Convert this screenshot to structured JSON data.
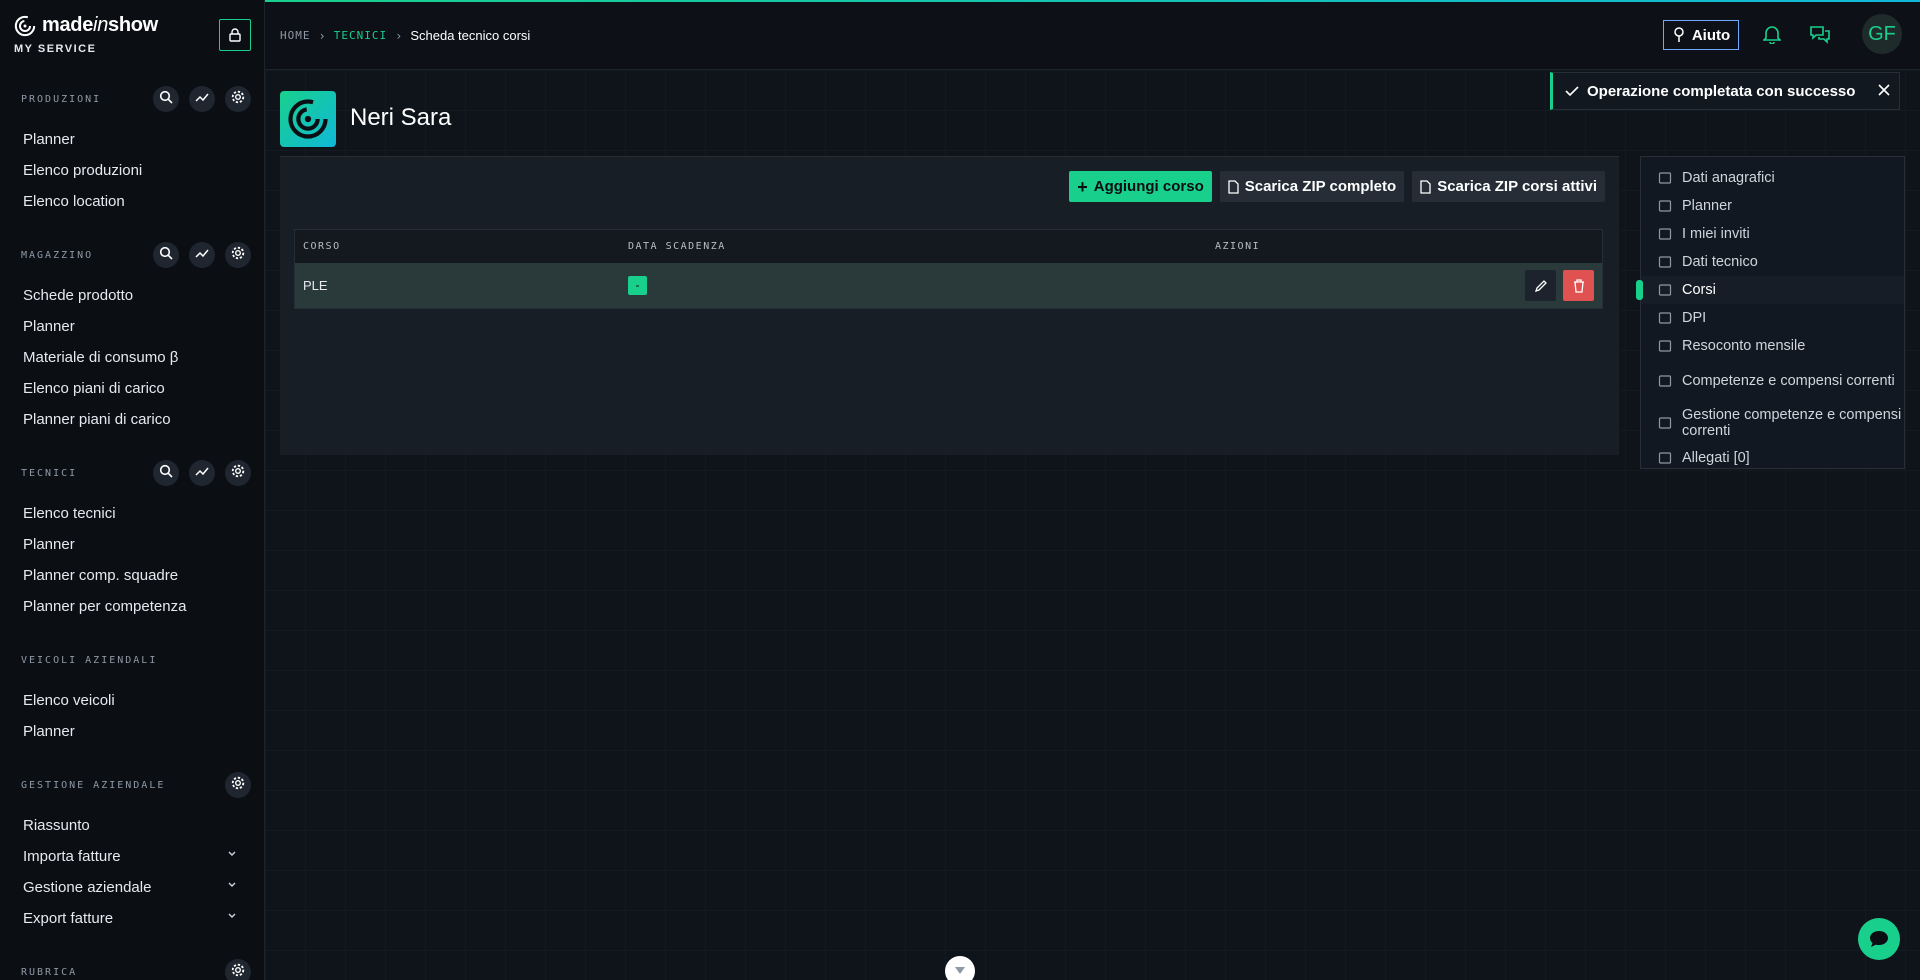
{
  "brand": {
    "name_pre": "made",
    "name_italic": "in",
    "name_post": "show",
    "sub": "MY SERVICE"
  },
  "sidebar": {
    "sections": [
      {
        "title": "PRODUZIONI",
        "tools": [
          "search-icon",
          "chart-icon",
          "gear-icon"
        ],
        "items": [
          "Planner",
          "Elenco produzioni",
          "Elenco location"
        ]
      },
      {
        "title": "MAGAZZINO",
        "tools": [
          "search-icon",
          "chart-icon",
          "gear-icon"
        ],
        "items": [
          "Schede prodotto",
          "Planner",
          "Materiale di consumo β",
          "Elenco piani di carico",
          "Planner piani di carico"
        ]
      },
      {
        "title": "TECNICI",
        "tools": [
          "search-icon",
          "chart-icon",
          "gear-icon"
        ],
        "items": [
          "Elenco tecnici",
          "Planner",
          "Planner comp. squadre",
          "Planner per competenza"
        ]
      },
      {
        "title": "VEICOLI AZIENDALI",
        "tools": [],
        "items": [
          "Elenco veicoli",
          "Planner"
        ]
      },
      {
        "title": "GESTIONE AZIENDALE",
        "tools": [
          "gear-icon"
        ],
        "items": [
          "Riassunto",
          "Importa fatture",
          "Gestione aziendale",
          "Export fatture"
        ]
      },
      {
        "title": "RUBRICA",
        "tools": [
          "gear-icon"
        ],
        "items": []
      }
    ]
  },
  "breadcrumb": {
    "home": "HOME",
    "section": "TECNICI",
    "current": "Scheda tecnico corsi"
  },
  "topbar": {
    "help_label": "Aiuto",
    "avatar_initials": "GF"
  },
  "profile": {
    "name": "Neri Sara"
  },
  "actions": {
    "add": "Aggiungi corso",
    "zip_all": "Scarica ZIP completo",
    "zip_active": "Scarica ZIP corsi attivi"
  },
  "table": {
    "headers": [
      "CORSO",
      "DATA SCADENZA",
      "AZIONI"
    ],
    "rows": [
      {
        "corso": "PLE",
        "scadenza": "-"
      }
    ]
  },
  "right_nav": {
    "items": [
      {
        "label": "Dati anagrafici",
        "icon": "id-card-icon"
      },
      {
        "label": "Planner",
        "icon": "calendar-icon"
      },
      {
        "label": "I miei inviti",
        "icon": "invite-icon"
      },
      {
        "label": "Dati tecnico",
        "icon": "user-icon"
      },
      {
        "label": "Corsi",
        "icon": "graduation-cap-icon",
        "active": true
      },
      {
        "label": "DPI",
        "icon": "helmet-icon"
      },
      {
        "label": "Resoconto mensile",
        "icon": "file-icon"
      },
      {
        "label": "Competenze e compensi correnti",
        "icon": "toolbox-icon"
      },
      {
        "label": "Gestione competenze e compensi correnti",
        "icon": "hand-money-icon"
      },
      {
        "label": "Allegati [0]",
        "icon": "paperclip-icon"
      }
    ]
  },
  "toast": {
    "message": "Operazione completata con successo"
  },
  "colors": {
    "accent": "#18d08c",
    "danger": "#e05151",
    "background": "#0f141b"
  }
}
